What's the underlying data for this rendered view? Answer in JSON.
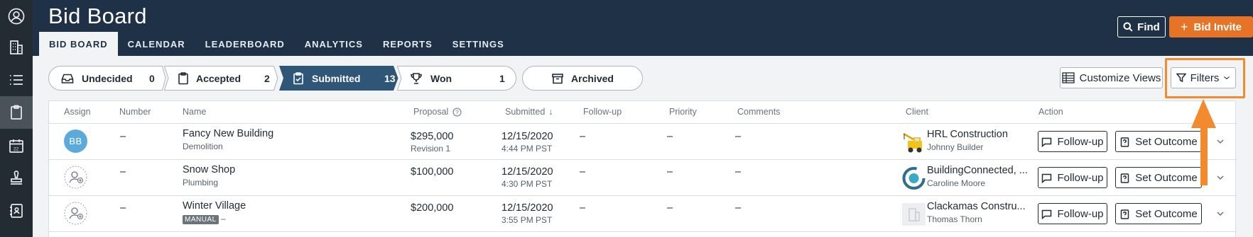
{
  "app": {
    "title": "Bid Board",
    "tabs": [
      {
        "label": "BID BOARD",
        "active": true
      },
      {
        "label": "CALENDAR",
        "active": false
      },
      {
        "label": "LEADERBOARD",
        "active": false
      },
      {
        "label": "ANALYTICS",
        "active": false
      },
      {
        "label": "REPORTS",
        "active": false
      },
      {
        "label": "SETTINGS",
        "active": false
      }
    ],
    "find_label": "Find",
    "bid_invite_label": "Bid Invite",
    "bid_invite_icon": "+"
  },
  "rail": [
    {
      "icon": "account-icon",
      "active": false
    },
    {
      "icon": "building-icon",
      "active": false
    },
    {
      "icon": "list-icon",
      "active": false
    },
    {
      "icon": "clipboard-icon",
      "active": true
    },
    {
      "icon": "calendar-icon",
      "active": false
    },
    {
      "icon": "stamp-icon",
      "active": false
    },
    {
      "icon": "address-book-icon",
      "active": false
    }
  ],
  "stages": [
    {
      "label": "Undecided",
      "count": "0",
      "icon": "inbox-icon",
      "active": false
    },
    {
      "label": "Accepted",
      "count": "2",
      "icon": "clipboard-icon",
      "active": false
    },
    {
      "label": "Submitted",
      "count": "13",
      "icon": "clipboard-check-icon",
      "active": true
    },
    {
      "label": "Won",
      "count": "1",
      "icon": "trophy-icon",
      "active": false
    }
  ],
  "archived_label": "Archived",
  "customize_views_label": "Customize Views",
  "filters_label": "Filters",
  "colors": {
    "header": "#1f3147",
    "rail": "#232b33",
    "active_stage": "#2f5577",
    "accent_orange": "#e77327",
    "avatar_blue": "#5baadb"
  },
  "table": {
    "columns": [
      "Assign",
      "Number",
      "Name",
      "Proposal",
      "Submitted",
      "Follow-up",
      "Priority",
      "Comments",
      "Client",
      "Action"
    ],
    "sort_arrow": "↓",
    "rows": [
      {
        "assign_initials": "BB",
        "number": "–",
        "name": "Fancy New Building",
        "trade": "Demolition",
        "proposal": "$295,000",
        "revision": "Revision 1",
        "submitted_date": "12/15/2020",
        "submitted_time": "4:44 PM PST",
        "followup": "–",
        "priority": "–",
        "comments": "–",
        "client": "HRL Construction",
        "contact": "Johnny Builder",
        "followup_btn": "Follow-up",
        "outcome_btn": "Set Outcome"
      },
      {
        "assign_initials": "",
        "number": "–",
        "name": "Snow Shop",
        "trade": "Plumbing",
        "proposal": "$100,000",
        "revision": "",
        "submitted_date": "12/15/2020",
        "submitted_time": "4:30 PM PST",
        "followup": "–",
        "priority": "–",
        "comments": "–",
        "client": "BuildingConnected, ...",
        "contact": "Caroline Moore",
        "followup_btn": "Follow-up",
        "outcome_btn": "Set Outcome"
      },
      {
        "assign_initials": "",
        "number": "–",
        "name": "Winter Village",
        "manual_badge": "MANUAL",
        "trade": "–",
        "proposal": "$200,000",
        "revision": "",
        "submitted_date": "12/15/2020",
        "submitted_time": "3:55 PM PST",
        "followup": "–",
        "priority": "–",
        "comments": "–",
        "client": "Clackamas Constru...",
        "contact": "Thomas Thorn",
        "followup_btn": "Follow-up",
        "outcome_btn": "Set Outcome"
      }
    ]
  }
}
